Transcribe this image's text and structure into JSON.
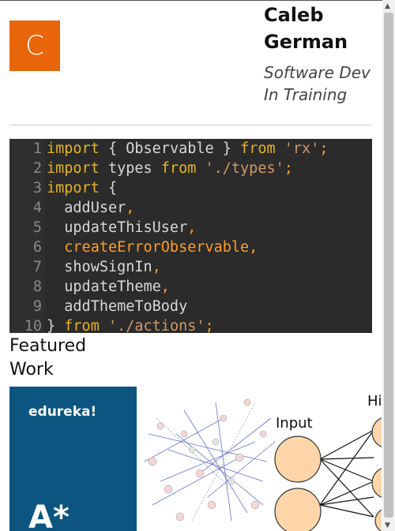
{
  "profile": {
    "avatar_letter": "C",
    "name": "Caleb German",
    "tagline": "Software Dev In Training"
  },
  "code": {
    "lines": [
      {
        "n": "1",
        "tokens": [
          [
            "kw",
            "import"
          ],
          [
            "id",
            " { "
          ],
          [
            "id",
            "Observable"
          ],
          [
            "id",
            " } "
          ],
          [
            "kw",
            "from"
          ],
          [
            "str",
            " 'rx'"
          ],
          [
            "hl",
            ";"
          ]
        ]
      },
      {
        "n": "2",
        "tokens": [
          [
            "kw",
            "import"
          ],
          [
            "id",
            " types "
          ],
          [
            "kw",
            "from"
          ],
          [
            "str",
            " './types'"
          ],
          [
            "hl",
            ";"
          ]
        ]
      },
      {
        "n": "3",
        "tokens": [
          [
            "kw",
            "import"
          ],
          [
            "id",
            " {"
          ]
        ]
      },
      {
        "n": "4",
        "tokens": [
          [
            "id",
            "  addUser"
          ],
          [
            "hl",
            ","
          ]
        ]
      },
      {
        "n": "5",
        "tokens": [
          [
            "id",
            "  updateThisUser"
          ],
          [
            "hl",
            ","
          ]
        ]
      },
      {
        "n": "6",
        "tokens": [
          [
            "hl",
            "  createErrorObservable,"
          ]
        ]
      },
      {
        "n": "7",
        "tokens": [
          [
            "id",
            "  showSignIn"
          ],
          [
            "hl",
            ","
          ]
        ]
      },
      {
        "n": "8",
        "tokens": [
          [
            "id",
            "  updateTheme"
          ],
          [
            "hl",
            ","
          ]
        ]
      },
      {
        "n": "9",
        "tokens": [
          [
            "id",
            "  addThemeToBody"
          ]
        ]
      },
      {
        "n": "10",
        "tokens": [
          [
            "id",
            "} "
          ],
          [
            "kw",
            "from"
          ],
          [
            "str",
            " './actions'"
          ],
          [
            "hl",
            ";"
          ]
        ]
      }
    ]
  },
  "featured": {
    "heading": "Featured Work",
    "card1_label": "edureka!",
    "card1_mark": "A*",
    "card2_input_label": "Input",
    "card2_hidden_label": "Hi"
  },
  "colors": {
    "avatar_bg": "#e8650a",
    "code_bg": "#2b2b2b",
    "card1_bg": "#0b5580"
  }
}
